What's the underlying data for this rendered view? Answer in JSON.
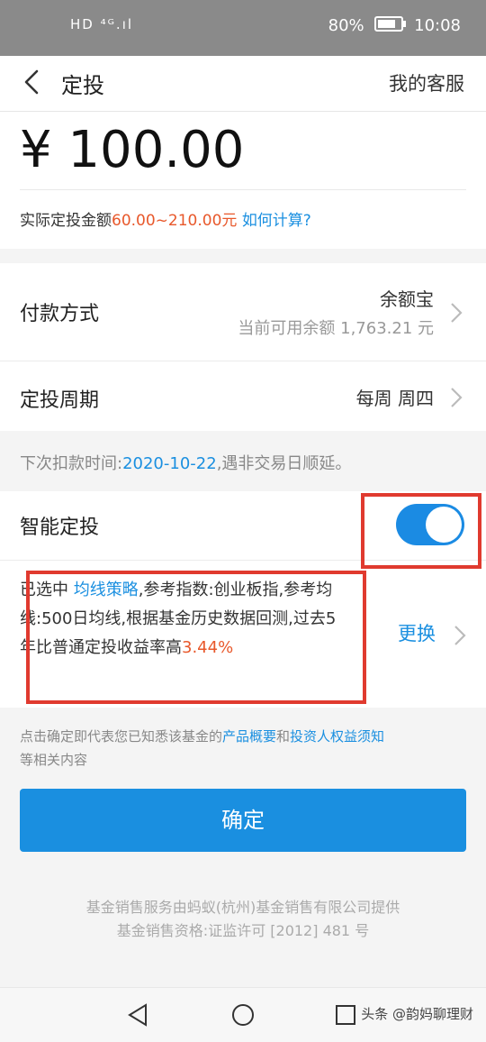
{
  "status_bar": {
    "left_indicators": "HD ⁴ᴳ.ıl  ",
    "battery": "80%",
    "battery_level": 0.8,
    "time": "10:08"
  },
  "nav": {
    "title": "定投",
    "support": "我的客服"
  },
  "amount": {
    "value": "¥ 100.00",
    "actual_prefix": "实际定投金额",
    "actual_range": "60.00~210.00元",
    "how_link": "如何计算?"
  },
  "payment": {
    "label": "付款方式",
    "method": "余额宝",
    "balance": "当前可用余额 1,763.21 元"
  },
  "cycle": {
    "label": "定投周期",
    "value": "每周 周四"
  },
  "next_deduction": {
    "prefix": "下次扣款时间:",
    "date": "2020-10-22",
    "suffix": ",遇非交易日顺延。"
  },
  "smart": {
    "label": "智能定投",
    "enabled": true,
    "text_1": "已选中 ",
    "strategy": "均线策略",
    "text_2": ",参考指数:创业板指,参考均线:500日均线,根据基金历史数据回测,过去5年比普通定投收益率高",
    "rate": "3.44%",
    "change_label": "更换"
  },
  "notice": {
    "text_1": "点击确定即代表您已知悉该基金的",
    "link_1": "产品概要",
    "text_2": "和",
    "link_2": "投资人权益须知",
    "text_3": "等相关内容"
  },
  "confirm_label": "确定",
  "footer": {
    "line1": "基金销售服务由蚂蚁(杭州)基金销售有限公司提供",
    "line2": "基金销售资格:证监许可 [2012] 481 号"
  },
  "watermark": "头条 @韵妈聊理财",
  "colors": {
    "accent": "#1a8fe0",
    "highlight": "#e03a2f",
    "orange": "#e8582b"
  }
}
